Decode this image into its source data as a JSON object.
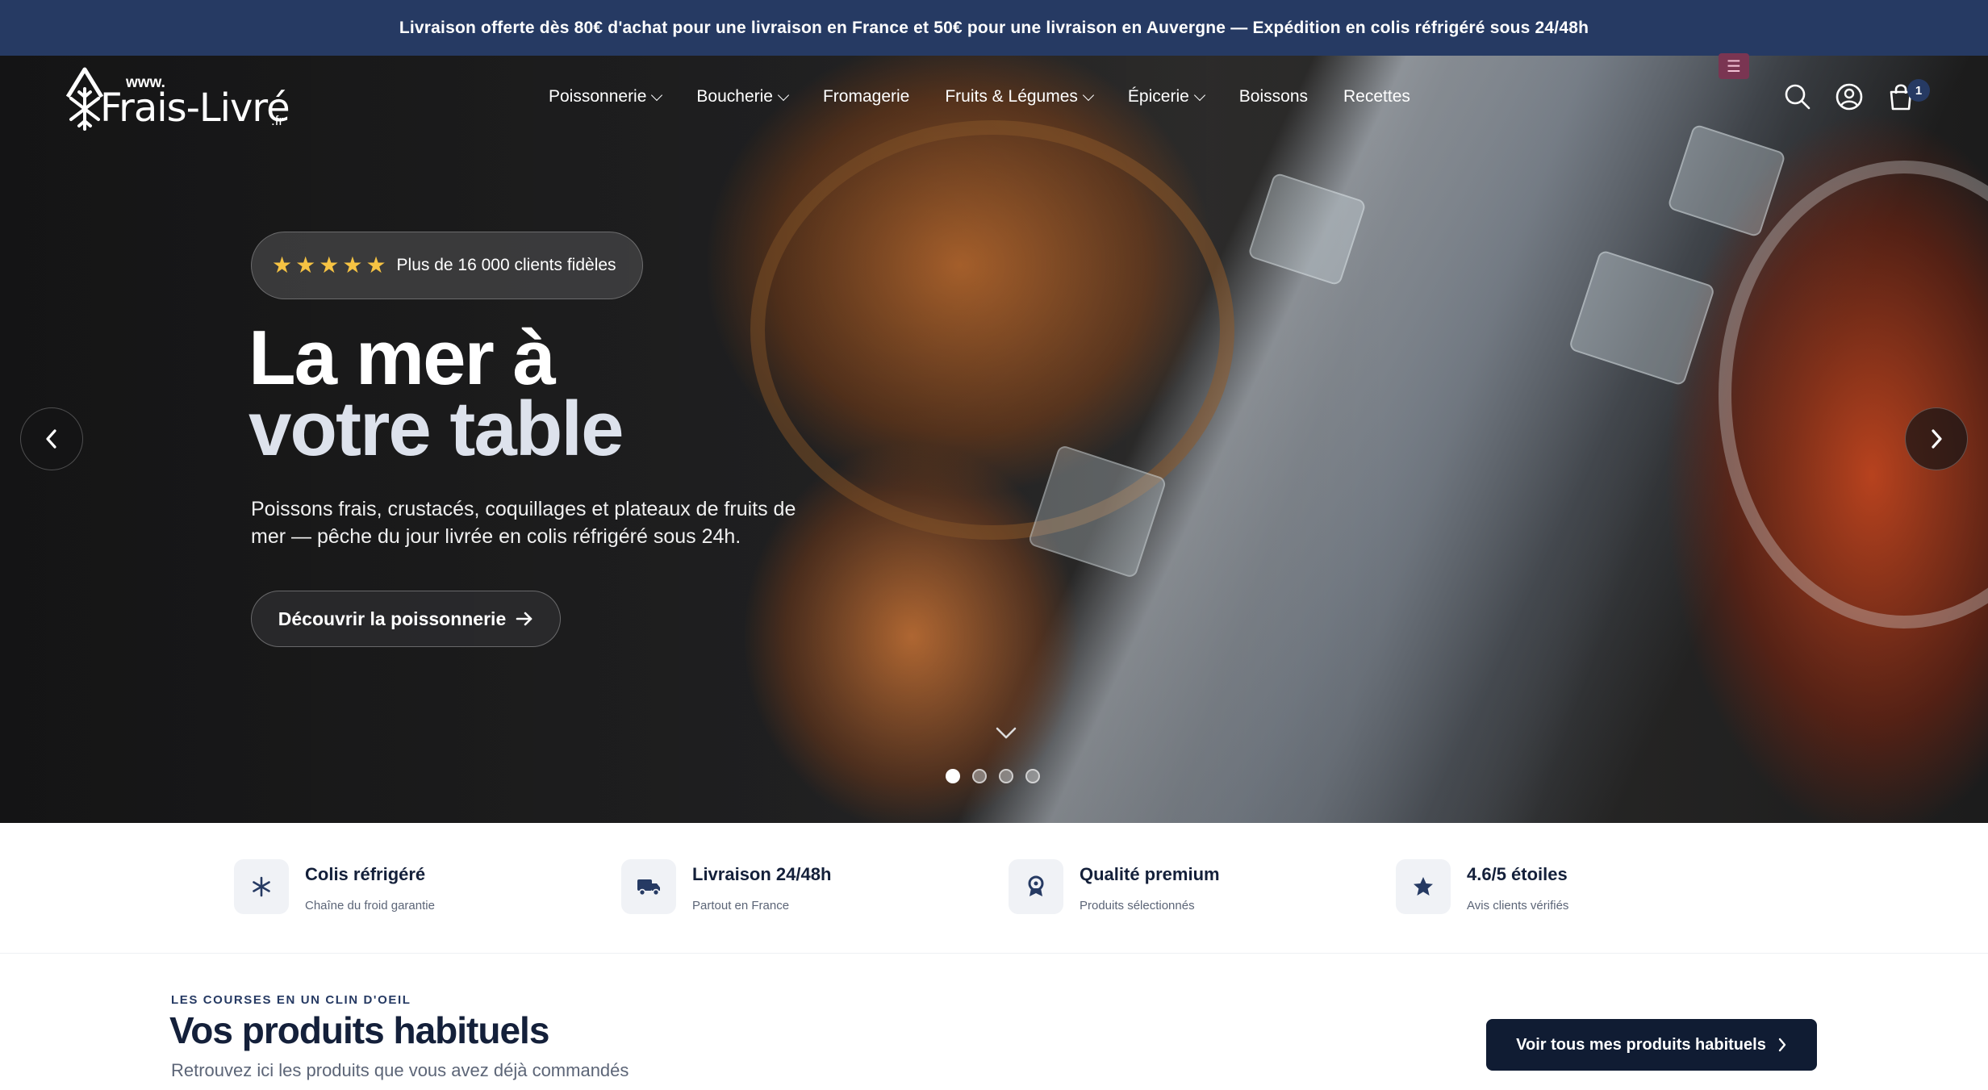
{
  "announcement": "Livraison offerte dès 80€ d'achat pour une livraison en France et 50€ pour une livraison en Auvergne — Expédition en colis réfrigéré sous 24/48h",
  "logo": {
    "www": "www.",
    "brand": "Frais-Livré",
    "tld": ".fr",
    "icon": "snowflake-house-icon"
  },
  "nav": {
    "items": [
      {
        "label": "Poissonnerie",
        "dropdown": true
      },
      {
        "label": "Boucherie",
        "dropdown": true
      },
      {
        "label": "Fromagerie",
        "dropdown": false
      },
      {
        "label": "Fruits & Légumes",
        "dropdown": true
      },
      {
        "label": "Épicerie",
        "dropdown": true
      },
      {
        "label": "Boissons",
        "dropdown": false
      },
      {
        "label": "Recettes",
        "dropdown": false
      }
    ],
    "menu_badge": "☰",
    "cart_count": "1",
    "icons": [
      "search-icon",
      "account-icon",
      "cart-icon"
    ]
  },
  "hero": {
    "rating_text": "Plus de 16 000 clients fidèles",
    "rating_stars": 5,
    "title_line1": "La mer à",
    "title_line2": "votre table",
    "subtitle": "Poissons frais, crustacés, coquillages et plateaux de fruits de mer — pêche du jour livrée en colis réfrigéré sous 24h.",
    "cta_label": "Découvrir la poissonnerie",
    "slides": 4,
    "active_slide": 1
  },
  "features": [
    {
      "title": "Colis réfrigéré",
      "subtitle": "Chaîne du froid garantie",
      "icon": "snowflake-icon"
    },
    {
      "title": "Livraison 24/48h",
      "subtitle": "Partout en France",
      "icon": "truck-icon"
    },
    {
      "title": "Qualité premium",
      "subtitle": "Produits sélectionnés",
      "icon": "award-icon"
    },
    {
      "title": "4.6/5 étoiles",
      "subtitle": "Avis clients vérifiés",
      "icon": "star-icon"
    }
  ],
  "products_section": {
    "eyebrow": "LES COURSES EN UN CLIN D'OEIL",
    "title": "Vos produits habituels",
    "subtitle": "Retrouvez ici les produits que vous avez déjà commandés",
    "button_label": "Voir tous mes produits habituels"
  },
  "colors": {
    "topbar": "#263a63",
    "dark_button": "#101c33",
    "star": "#f6c343"
  }
}
